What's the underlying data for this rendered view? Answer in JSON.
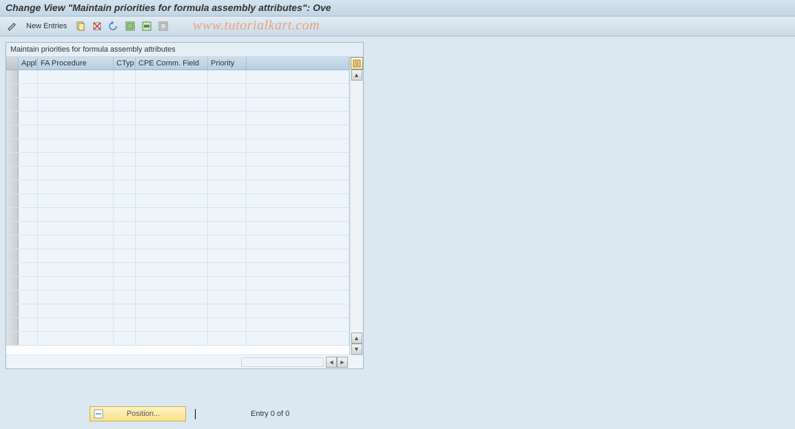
{
  "title": "Change View \"Maintain priorities for formula assembly attributes\": Ove",
  "toolbar": {
    "new_entries": "New Entries"
  },
  "watermark": "www.tutorialkart.com",
  "table": {
    "caption": "Maintain priorities for formula assembly attributes",
    "columns": {
      "appl": "Appl",
      "fa": "FA Procedure",
      "ctyp": "CTyp",
      "cpe": "CPE Comm. Field",
      "prio": "Priority"
    },
    "row_count": 20
  },
  "footer": {
    "position_label": "Position...",
    "entry_text": "Entry 0 of 0"
  }
}
